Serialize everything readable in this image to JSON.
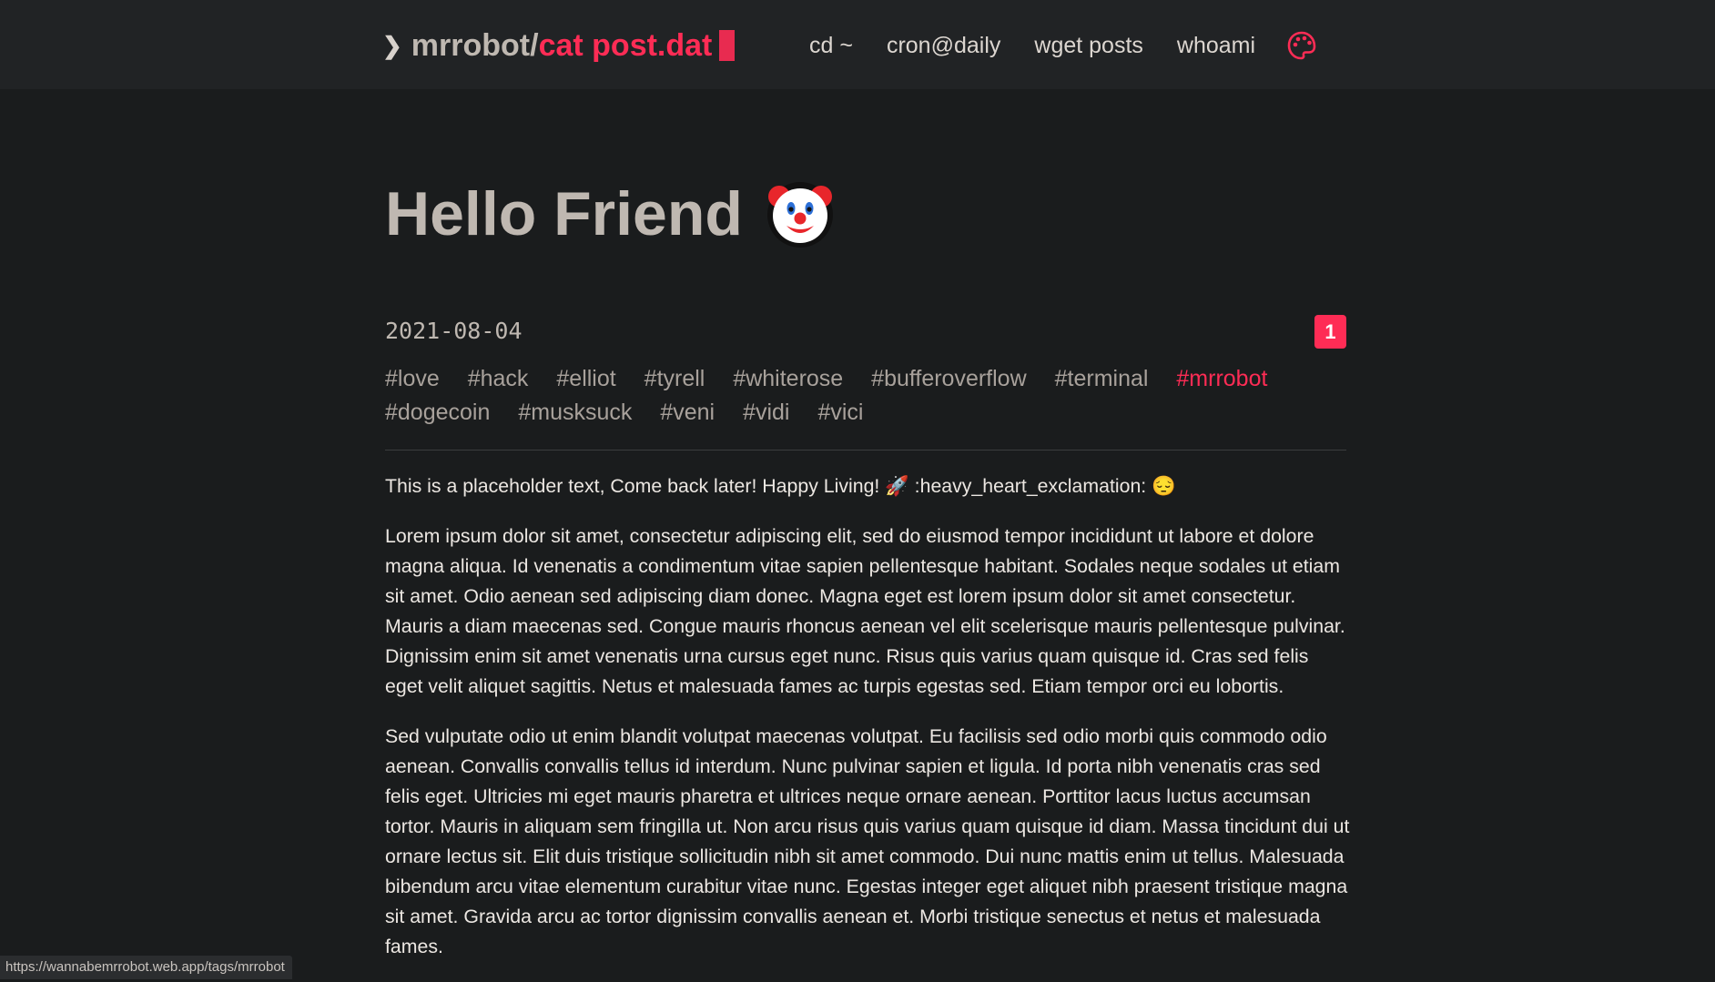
{
  "header": {
    "logo_prefix": "mrrobot/",
    "logo_accent": "cat post.dat",
    "nav": [
      "cd ~",
      "cron@daily",
      "wget posts",
      "whoami"
    ],
    "theme_icon": "palette-icon"
  },
  "post": {
    "title": "Hello Friend",
    "title_emoji": "clown-face",
    "date": "2021-08-04",
    "count_badge": "1",
    "tags": [
      "#love",
      "#hack",
      "#elliot",
      "#tyrell",
      "#whiterose",
      "#bufferoverflow",
      "#terminal",
      "#mrrobot",
      "#dogecoin",
      "#musksuck",
      "#veni",
      "#vidi",
      "#vici"
    ],
    "active_tag": "#mrrobot",
    "paragraphs": [
      "This is a placeholder text, Come back later! Happy Living! 🚀 :heavy_heart_exclamation: 😔",
      "Lorem ipsum dolor sit amet, consectetur adipiscing elit, sed do eiusmod tempor incididunt ut labore et dolore magna aliqua. Id venenatis a condimentum vitae sapien pellentesque habitant. Sodales neque sodales ut etiam sit amet. Odio aenean sed adipiscing diam donec. Magna eget est lorem ipsum dolor sit amet consectetur. Mauris a diam maecenas sed. Congue mauris rhoncus aenean vel elit scelerisque mauris pellentesque pulvinar. Dignissim enim sit amet venenatis urna cursus eget nunc. Risus quis varius quam quisque id. Cras sed felis eget velit aliquet sagittis. Netus et malesuada fames ac turpis egestas sed. Etiam tempor orci eu lobortis.",
      "Sed vulputate odio ut enim blandit volutpat maecenas volutpat. Eu facilisis sed odio morbi quis commodo odio aenean. Convallis convallis tellus id interdum. Nunc pulvinar sapien et ligula. Id porta nibh venenatis cras sed felis eget. Ultricies mi eget mauris pharetra et ultrices neque ornare aenean. Porttitor lacus luctus accumsan tortor. Mauris in aliquam sem fringilla ut. Non arcu risus quis varius quam quisque id diam. Massa tincidunt dui ut ornare lectus sit. Elit duis tristique sollicitudin nibh sit amet commodo. Dui nunc mattis enim ut tellus. Malesuada bibendum arcu vitae elementum curabitur vitae nunc. Egestas integer eget aliquet nibh praesent tristique magna sit amet. Gravida arcu ac tortor dignissim convallis aenean et. Morbi tristique senectus et netus et malesuada fames."
    ]
  },
  "status_bar": {
    "url": "https://wannabemrrobot.web.app/tags/mrrobot"
  },
  "colors": {
    "accent": "#fe2c55",
    "background": "#1a1c1d",
    "header_background": "#212325"
  }
}
